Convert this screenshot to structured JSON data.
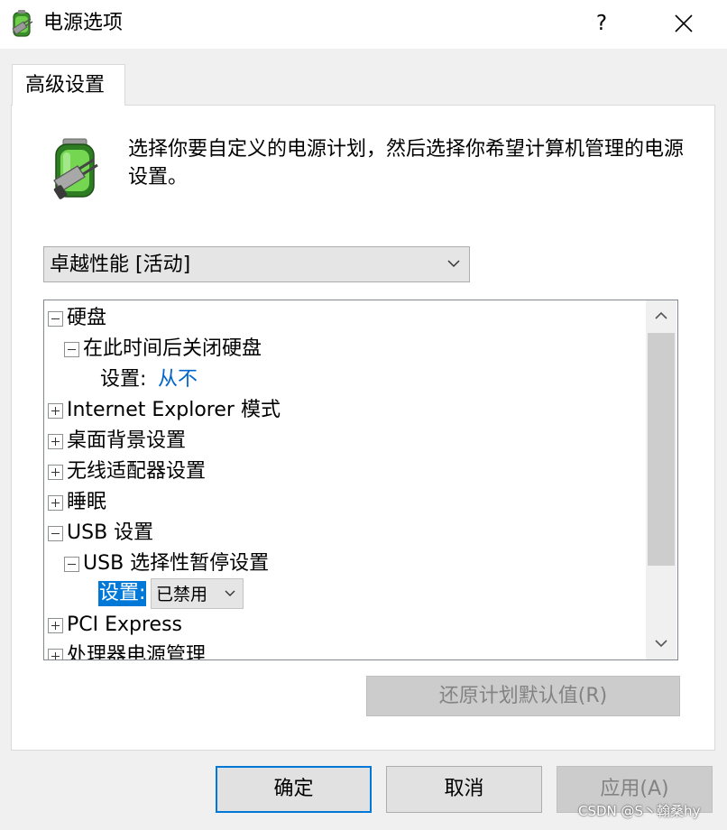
{
  "window": {
    "title": "电源选项",
    "help_label": "?"
  },
  "tab": {
    "label": "高级设置"
  },
  "description": "选择你要自定义的电源计划，然后选择你希望计算机管理的电源设置。",
  "plan_select": {
    "value": "卓越性能 [活动]"
  },
  "tree": {
    "items": [
      {
        "label": "硬盘",
        "expander": "minus"
      },
      {
        "label": "在此时间后关闭硬盘",
        "expander": "minus"
      },
      {
        "setting_label": "设置:",
        "setting_value": "从不"
      },
      {
        "label": "Internet Explorer 模式",
        "expander": "plus"
      },
      {
        "label": "桌面背景设置",
        "expander": "plus"
      },
      {
        "label": "无线适配器设置",
        "expander": "plus"
      },
      {
        "label": "睡眠",
        "expander": "plus"
      },
      {
        "label": "USB 设置",
        "expander": "minus"
      },
      {
        "label": "USB 选择性暂停设置",
        "expander": "minus"
      },
      {
        "setting_label": "设置:",
        "setting_value": "已禁用"
      },
      {
        "label": "PCI Express",
        "expander": "plus"
      },
      {
        "label": "处理器电源管理",
        "expander": "plus"
      }
    ]
  },
  "buttons": {
    "restore": "还原计划默认值(R)",
    "ok": "确定",
    "cancel": "取消",
    "apply": "应用(A)"
  },
  "watermark": "CSDN @S丶翰桑hy",
  "colors": {
    "selection": "#0078d7",
    "link_value": "#0066cc",
    "default_button_border": "#0078d7"
  }
}
